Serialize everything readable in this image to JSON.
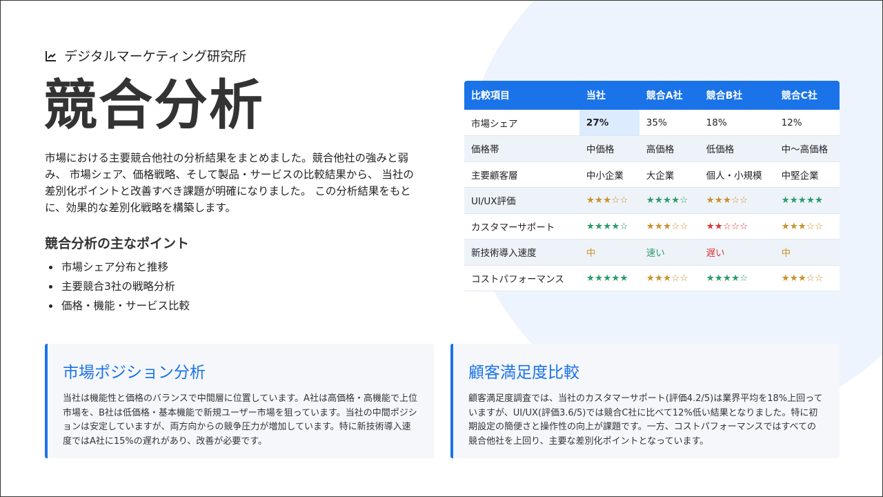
{
  "brand": {
    "name": "デジタルマーケティング研究所",
    "icon": "line-chart-icon"
  },
  "title": "競合分析",
  "description": "市場における主要競合他社の分析結果をまとめました。競合他社の強みと弱み、 市場シェア、価格戦略、そして製品・サービスの比較結果から、 当社の差別化ポイントと改善すべき課題が明確になりました。 この分析結果をもとに、効果的な差別化戦略を構築します。",
  "points": {
    "title": "競合分析の主なポイント",
    "items": [
      "市場シェア分布と推移",
      "主要競合3社の戦略分析",
      "価格・機能・サービス比較"
    ]
  },
  "table": {
    "headers": [
      "比較項目",
      "当社",
      "競合A社",
      "競合B社",
      "競合C社"
    ],
    "rows": [
      {
        "cells": [
          {
            "text": "市場シェア"
          },
          {
            "text": "27%",
            "hl": true
          },
          {
            "text": "35%"
          },
          {
            "text": "18%"
          },
          {
            "text": "12%"
          }
        ]
      },
      {
        "cells": [
          {
            "text": "価格帯"
          },
          {
            "text": "中価格"
          },
          {
            "text": "高価格"
          },
          {
            "text": "低価格"
          },
          {
            "text": "中～高価格"
          }
        ]
      },
      {
        "cells": [
          {
            "text": "主要顧客層"
          },
          {
            "text": "中小企業"
          },
          {
            "text": "大企業"
          },
          {
            "text": "個人・小規模"
          },
          {
            "text": "中堅企業"
          }
        ]
      },
      {
        "cells": [
          {
            "text": "UI/UX評価"
          },
          {
            "text": "★★★☆☆",
            "color": "gold"
          },
          {
            "text": "★★★★☆",
            "color": "green"
          },
          {
            "text": "★★★☆☆",
            "color": "gold"
          },
          {
            "text": "★★★★★",
            "color": "green"
          }
        ]
      },
      {
        "cells": [
          {
            "text": "カスタマーサポート"
          },
          {
            "text": "★★★★☆",
            "color": "green"
          },
          {
            "text": "★★★☆☆",
            "color": "gold"
          },
          {
            "text": "★★☆☆☆",
            "color": "red"
          },
          {
            "text": "★★★☆☆",
            "color": "gold"
          }
        ]
      },
      {
        "cells": [
          {
            "text": "新技術導入速度"
          },
          {
            "text": "中",
            "color": "gold"
          },
          {
            "text": "速い",
            "color": "green"
          },
          {
            "text": "遅い",
            "color": "red"
          },
          {
            "text": "中",
            "color": "gold"
          }
        ]
      },
      {
        "cells": [
          {
            "text": "コストパフォーマンス"
          },
          {
            "text": "★★★★★",
            "color": "green"
          },
          {
            "text": "★★★☆☆",
            "color": "gold"
          },
          {
            "text": "★★★★☆",
            "color": "green"
          },
          {
            "text": "★★★☆☆",
            "color": "gold"
          }
        ]
      }
    ]
  },
  "cards": [
    {
      "title": "市場ポジション分析",
      "body": "当社は機能性と価格のバランスで中間層に位置しています。A社は高価格・高機能で上位市場を、B社は低価格・基本機能で新規ユーザー市場を狙っています。当社の中間ポジションは安定していますが、両方向からの競争圧力が増加しています。特に新技術導入速度ではA社に15%の遅れがあり、改善が必要です。"
    },
    {
      "title": "顧客満足度比較",
      "body": "顧客満足度調査では、当社のカスタマーサポート(評価4.2/5)は業界平均を18%上回っていますが、UI/UX(評価3.6/5)では競合C社に比べて12%低い結果となりました。特に初期設定の簡便さと操作性の向上が課題です。一方、コストパフォーマンスではすべての競合他社を上回り、主要な差別化ポイントとなっています。"
    }
  ],
  "colors": {
    "accent": "#1a73e8",
    "gold": "#c9922e",
    "green": "#2e9b6b",
    "red": "#d93a3a"
  }
}
